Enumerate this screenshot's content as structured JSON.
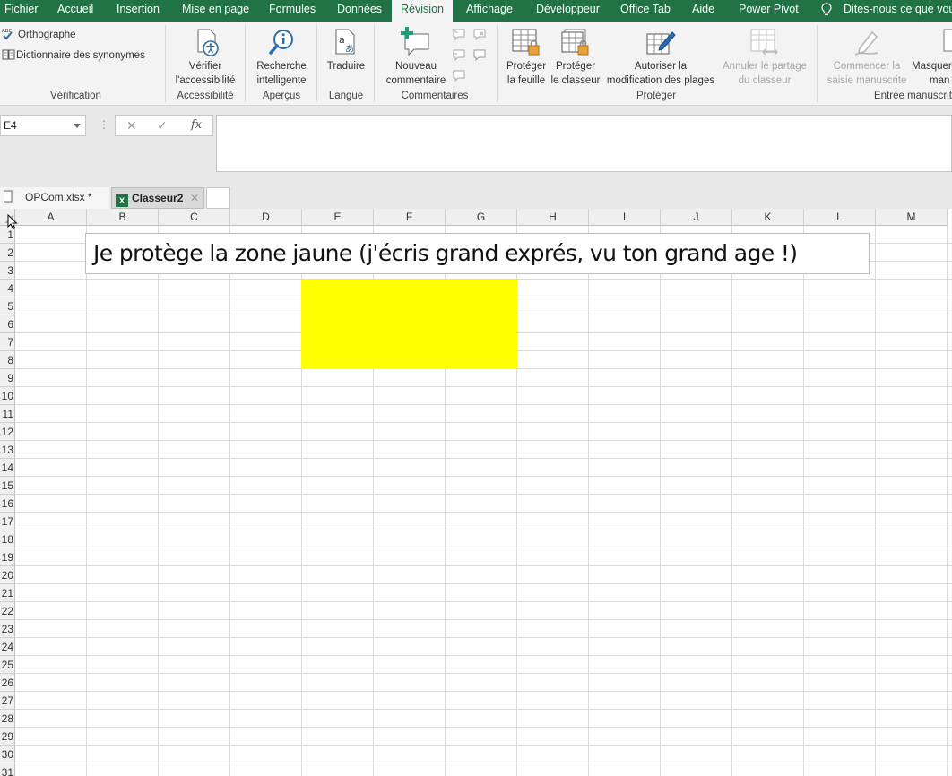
{
  "menu": {
    "tabs": [
      {
        "label": "Fichier"
      },
      {
        "label": "Accueil"
      },
      {
        "label": "Insertion"
      },
      {
        "label": "Mise en page"
      },
      {
        "label": "Formules"
      },
      {
        "label": "Données"
      },
      {
        "label": "Révision"
      },
      {
        "label": "Affichage"
      },
      {
        "label": "Développeur"
      },
      {
        "label": "Office Tab"
      },
      {
        "label": "Aide"
      },
      {
        "label": "Power Pivot"
      }
    ],
    "active_tab": "Révision",
    "tell_me": "Dites-nous ce que vous"
  },
  "ribbon": {
    "verification": {
      "spelling": "Orthographe",
      "thesaurus": "Dictionnaire des synonymes",
      "group": "Vérification"
    },
    "accessibility": {
      "line1": "Vérifier",
      "line2": "l'accessibilité",
      "group": "Accessibilité"
    },
    "insights": {
      "line1": "Recherche",
      "line2": "intelligente",
      "group": "Aperçus"
    },
    "language": {
      "translate": "Traduire",
      "group": "Langue"
    },
    "comments": {
      "line1": "Nouveau",
      "line2": "commentaire",
      "group": "Commentaires"
    },
    "protect": {
      "sheet_line1": "Protéger",
      "sheet_line2": "la feuille",
      "workbook_line1": "Protéger",
      "workbook_line2": "le classeur",
      "ranges_line1": "Autoriser la",
      "ranges_line2": "modification des plages",
      "unshare_line1": "Annuler le partage",
      "unshare_line2": "du classeur",
      "group": "Protéger"
    },
    "ink": {
      "start_line1": "Commencer la",
      "start_line2": "saisie manuscrite",
      "hide_line1": "Masquer",
      "hide_line2": "man",
      "group": "Entrée manuscrit"
    }
  },
  "formula_bar": {
    "name_box": "E4",
    "fx": "fx",
    "value": ""
  },
  "workbooks": [
    {
      "label": "OPCom.xlsx *"
    },
    {
      "label": "Classeur2",
      "active": true
    }
  ],
  "sheet": {
    "columns": [
      "A",
      "B",
      "C",
      "D",
      "E",
      "F",
      "G",
      "H",
      "I",
      "J",
      "K",
      "L",
      "M"
    ],
    "rows": [
      "1",
      "2",
      "3",
      "4",
      "5",
      "6",
      "7",
      "8",
      "9",
      "10",
      "11",
      "12",
      "13",
      "14",
      "15",
      "16",
      "17",
      "18",
      "19",
      "20",
      "21",
      "22",
      "23",
      "24",
      "25",
      "26",
      "27",
      "28",
      "29",
      "30",
      "31"
    ],
    "textbox": "Je protège la zone jaune (j'écris grand exprés, vu ton grand age !)",
    "highlight_color": "#FFFF00",
    "highlight_range": "E4:G8"
  },
  "colors": {
    "brand": "#217346",
    "ribbon_bg": "#F3F3F3",
    "highlight": "#FFFF00"
  }
}
